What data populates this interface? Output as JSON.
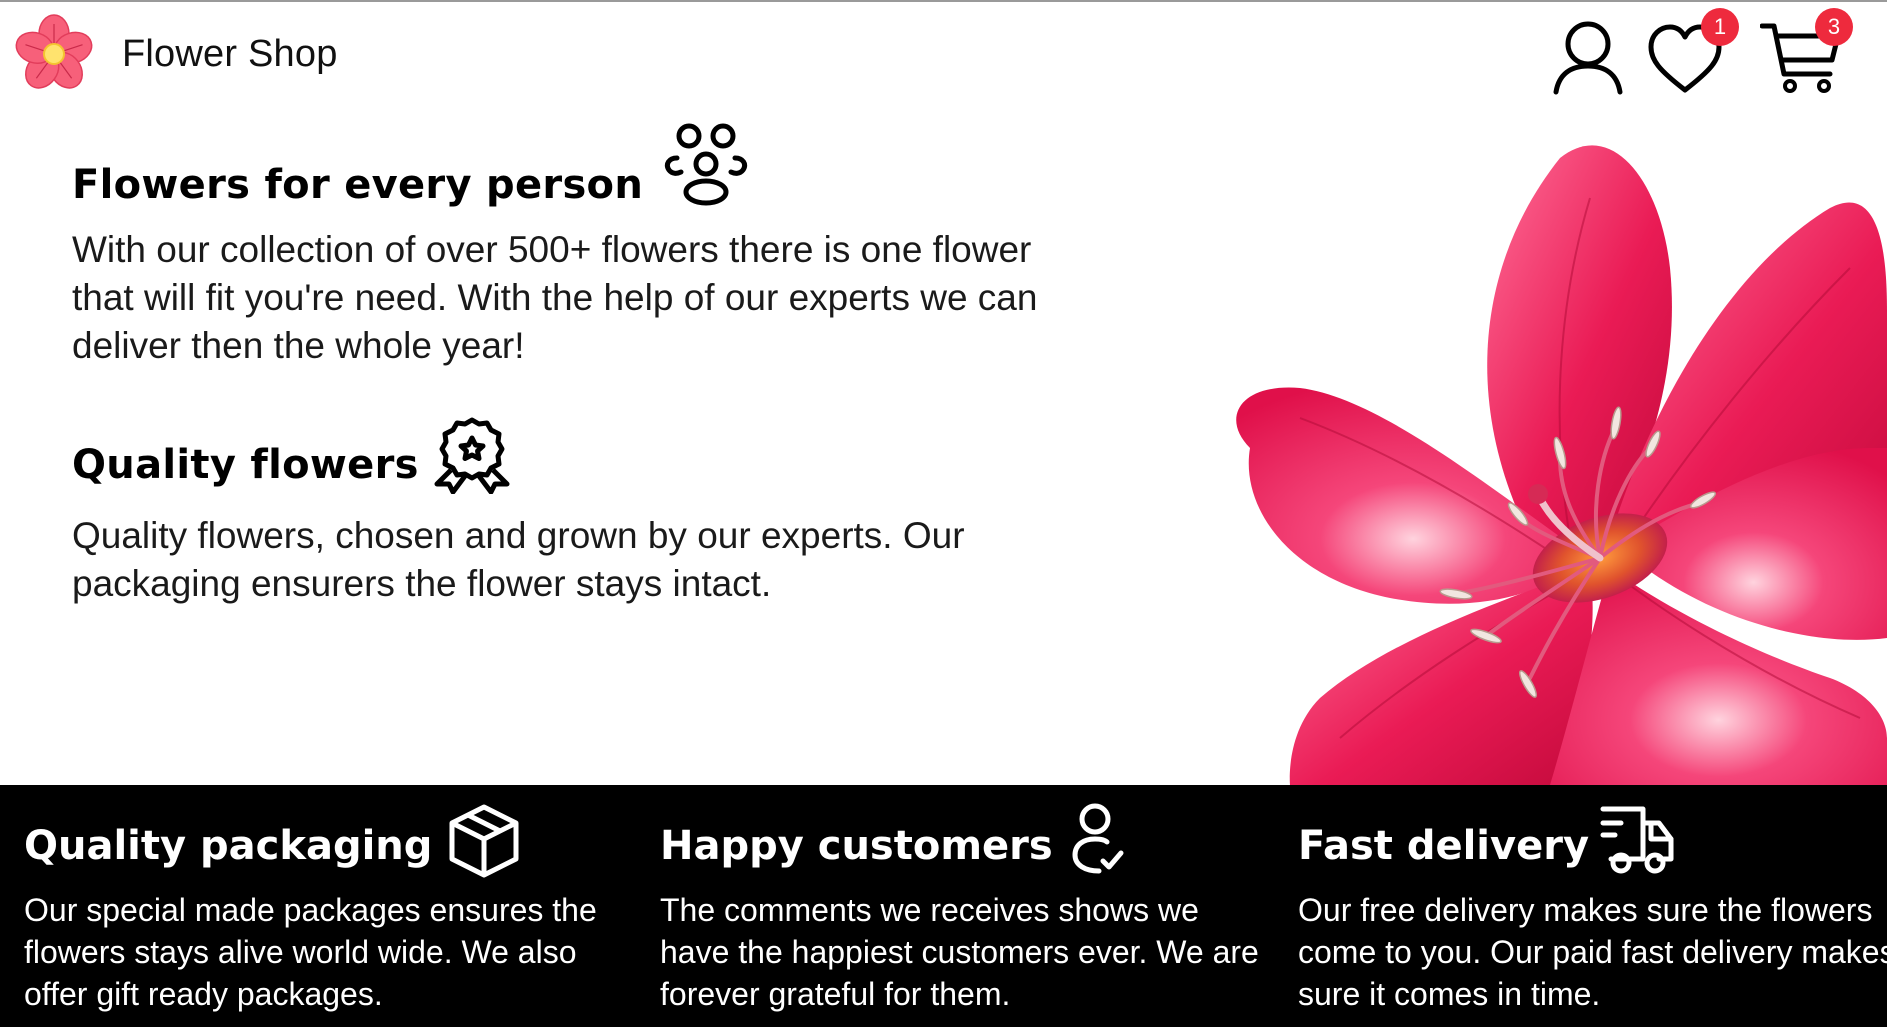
{
  "header": {
    "brand_name": "Flower Shop",
    "icons": [
      "flower-logo",
      "user-icon",
      "heart-icon",
      "cart-icon"
    ],
    "wishlist_count": "1",
    "cart_count": "3"
  },
  "hero": {
    "features": [
      {
        "title": "Flowers for every person",
        "icon": "people-group-icon",
        "text": "With our collection of over 500+ flowers there is one flower that will fit you're need. With the help of our experts we can deliver then the whole year!"
      },
      {
        "title": "Quality flowers",
        "icon": "award-badge-icon",
        "text": "Quality flowers, chosen and grown by our experts. Our packaging ensurers the flower stays intact."
      }
    ]
  },
  "band": {
    "items": [
      {
        "title": "Quality packaging",
        "icon": "package-box-icon",
        "text": "Our special made packages ensures the flowers stays alive world wide. We also offer gift ready packages."
      },
      {
        "title": "Happy customers",
        "icon": "user-check-icon",
        "text": "The comments we receives shows we have the happiest customers ever. We are forever grateful for them."
      },
      {
        "title": "Fast delivery",
        "icon": "delivery-truck-icon",
        "text": "Our free delivery makes sure the flowers come to you. Our paid fast delivery makes sure it comes in time."
      }
    ]
  },
  "colors": {
    "badge": "#ee2a3d",
    "band_background": "#000000",
    "flower_pink": "#e8174f"
  }
}
